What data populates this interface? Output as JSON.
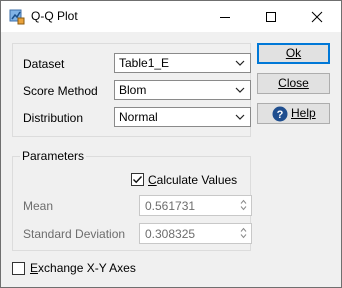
{
  "window": {
    "title": "Q-Q Plot"
  },
  "group1": {
    "dataset_label": "Dataset",
    "dataset_value": "Table1_E",
    "score_method_label": "Score Method",
    "score_method_value": "Blom",
    "distribution_label": "Distribution",
    "distribution_value": "Normal"
  },
  "parameters": {
    "title": "Parameters",
    "calculate_label": "Calculate Values",
    "calculate_checked": true,
    "mean_label": "Mean",
    "mean_value": "0.561731",
    "std_label": "Standard Deviation",
    "std_value": "0.308325"
  },
  "exchange": {
    "label": "Exchange X-Y Axes",
    "checked": false
  },
  "buttons": {
    "ok": "Ok",
    "close": "Close",
    "help": "Help"
  },
  "icons": {
    "app": "qq-plot-icon",
    "help": "help-question-icon"
  }
}
